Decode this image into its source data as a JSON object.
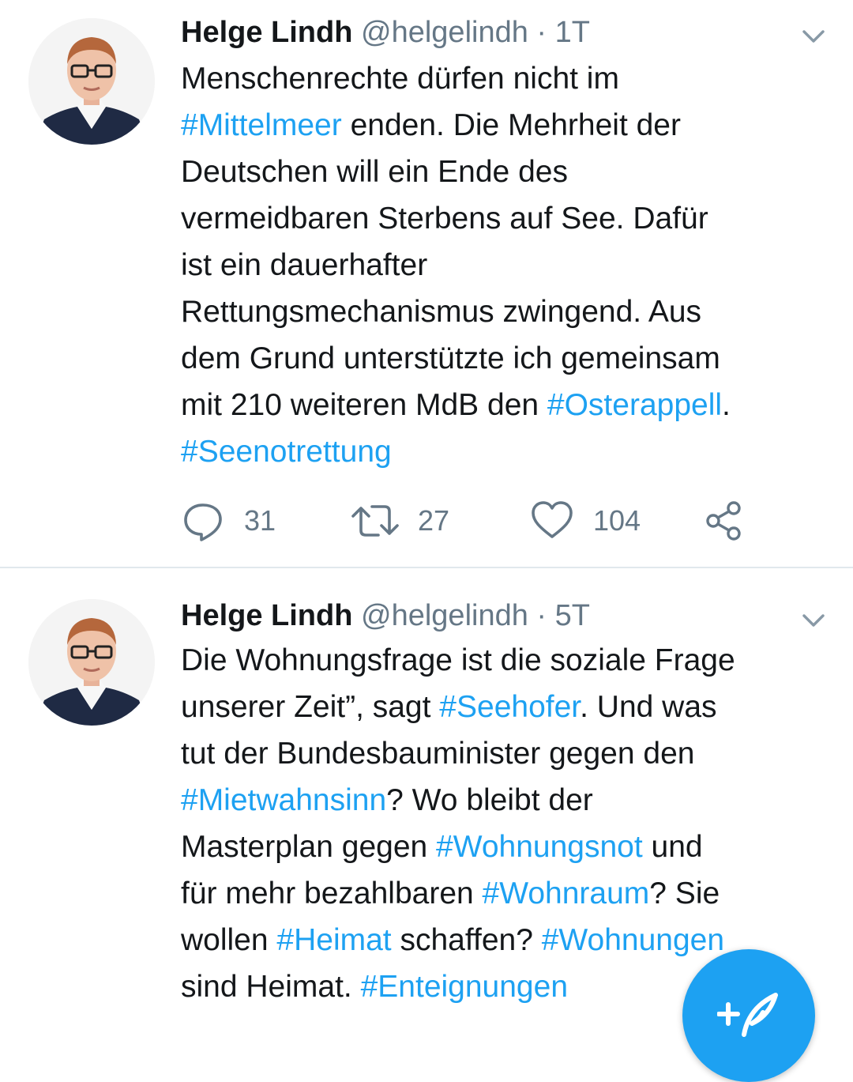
{
  "tweets": [
    {
      "author_name": "Helge Lindh",
      "handle": "@helgelindh",
      "separator": "·",
      "time": "1T",
      "text_lines": [
        [
          {
            "t": "Menschenrechte dürfen nicht im",
            "h": false
          }
        ],
        [
          {
            "t": "#Mittelmeer",
            "h": true
          },
          {
            "t": " enden. Die Mehrheit der",
            "h": false
          }
        ],
        [
          {
            "t": "Deutschen will ein Ende des",
            "h": false
          }
        ],
        [
          {
            "t": "vermeidbaren Sterbens auf See. Dafür",
            "h": false
          }
        ],
        [
          {
            "t": "ist ein dauerhafter",
            "h": false
          }
        ],
        [
          {
            "t": "Rettungsmechanismus zwingend. Aus",
            "h": false
          }
        ],
        [
          {
            "t": "dem Grund unterstützte ich gemeinsam",
            "h": false
          }
        ],
        [
          {
            "t": "mit 210 weiteren MdB den ",
            "h": false
          },
          {
            "t": "#Osterappell",
            "h": true
          },
          {
            "t": ".",
            "h": false
          }
        ],
        [
          {
            "t": "#Seenotrettung",
            "h": true
          }
        ]
      ],
      "replies": "31",
      "retweets": "27",
      "likes": "104"
    },
    {
      "author_name": "Helge Lindh",
      "handle": "@helgelindh",
      "separator": "·",
      "time": "5T",
      "text_lines": [
        [
          {
            "t": "Die Wohnungsfrage ist die soziale Frage",
            "h": false
          }
        ],
        [
          {
            "t": "unserer Zeit”, sagt ",
            "h": false
          },
          {
            "t": "#Seehofer",
            "h": true
          },
          {
            "t": ". Und was",
            "h": false
          }
        ],
        [
          {
            "t": "tut der Bundesbauminister gegen den",
            "h": false
          }
        ],
        [
          {
            "t": "#Mietwahnsinn",
            "h": true
          },
          {
            "t": "? Wo bleibt der",
            "h": false
          }
        ],
        [
          {
            "t": "Masterplan gegen ",
            "h": false
          },
          {
            "t": "#Wohnungsnot",
            "h": true
          },
          {
            "t": " und",
            "h": false
          }
        ],
        [
          {
            "t": "für mehr bezahlbaren ",
            "h": false
          },
          {
            "t": "#Wohnraum",
            "h": true
          },
          {
            "t": "? Sie",
            "h": false
          }
        ],
        [
          {
            "t": "wollen ",
            "h": false
          },
          {
            "t": "#Heimat",
            "h": true
          },
          {
            "t": " schaffen? ",
            "h": false
          },
          {
            "t": "#Wohnungen",
            "h": true
          }
        ],
        [
          {
            "t": "sind Heimat. ",
            "h": false
          },
          {
            "t": "#Enteignungen",
            "h": true
          }
        ]
      ]
    }
  ],
  "icons": {
    "avatar": "profile-photo",
    "chevron": "chevron-down-icon",
    "reply": "reply-bubble-icon",
    "retweet": "retweet-arrows-icon",
    "like": "heart-icon",
    "share": "share-icon",
    "compose": "compose-tweet-icon"
  },
  "colors": {
    "hashtag": "#1da1f2",
    "secondary_text": "#657786",
    "primary_text": "#14171a",
    "divider": "#e1e8ed",
    "fab": "#1da1f2"
  }
}
